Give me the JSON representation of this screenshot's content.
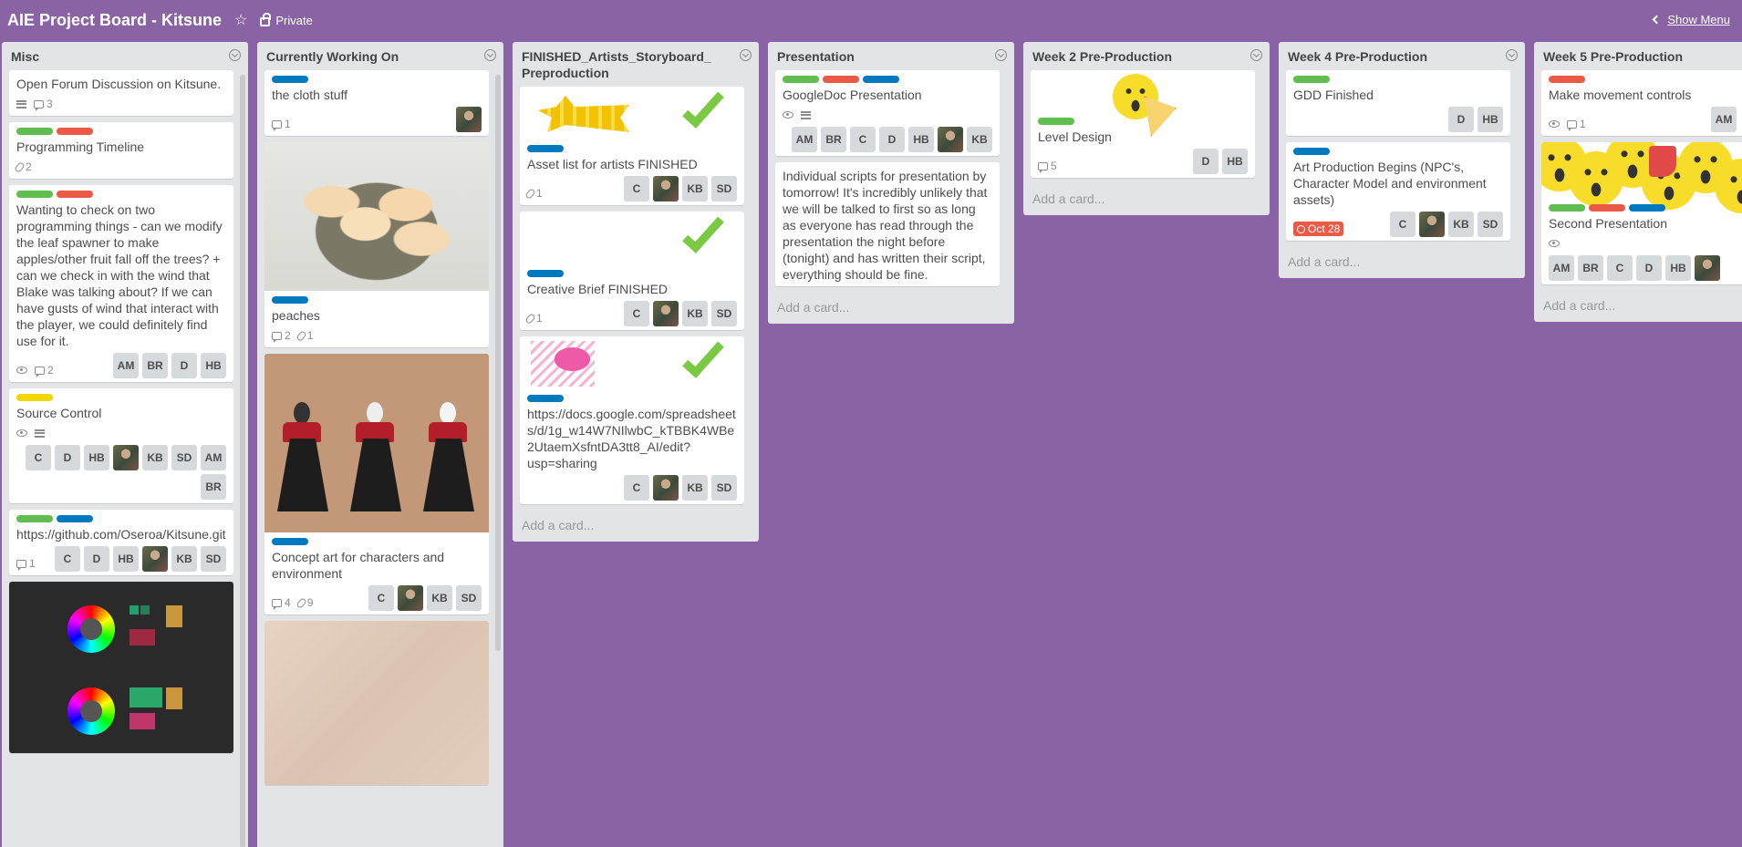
{
  "header": {
    "board_title": "AIE Project Board - Kitsune",
    "visibility": "Private",
    "show_menu": "Show Menu"
  },
  "colors": {
    "board_bg": "#8a63a4",
    "label_green": "#61bd4f",
    "label_red": "#eb5a46",
    "label_blue": "#0079bf",
    "label_yellow": "#f2d600"
  },
  "add_card": "Add a card...",
  "lists": [
    {
      "title": "Misc",
      "cards": [
        {
          "title": "Open Forum Discussion on Kitsune.",
          "comments": "3"
        },
        {
          "title": "Programming Timeline",
          "attachments": "2"
        },
        {
          "title": "Wanting to check on two programming things - can we modify the leaf spawner to make apples/other fruit fall off the trees? + can we check in with the wind that Blake was talking about? If we can have gusts of wind that interact with the player, we could definitely find use for it.",
          "comments": "2",
          "members": [
            "AM",
            "BR",
            "D",
            "HB"
          ]
        },
        {
          "title": "Source Control",
          "members": [
            "C",
            "D",
            "HB",
            "KB",
            "SD",
            "AM",
            "BR"
          ]
        },
        {
          "title": "https://github.com/Oseroa/Kitsune.git",
          "comments": "1",
          "members": [
            "C",
            "D",
            "HB",
            "KB",
            "SD"
          ]
        }
      ]
    },
    {
      "title": "Currently Working On",
      "cards": [
        {
          "title": "the cloth stuff",
          "comments": "1"
        },
        {
          "title": "peaches",
          "comments": "2",
          "attachments": "1"
        },
        {
          "title": "Concept art for characters and environment",
          "comments": "4",
          "attachments": "9",
          "members": [
            "C",
            "KB",
            "SD"
          ]
        }
      ]
    },
    {
      "title": "FINISHED_Artists_Storyboard_ Preproduction",
      "cards": [
        {
          "title": "Asset list for artists FINISHED",
          "attachments": "1",
          "members": [
            "C",
            "KB",
            "SD"
          ]
        },
        {
          "title": "Creative Brief FINISHED",
          "attachments": "1",
          "members": [
            "C",
            "KB",
            "SD"
          ]
        },
        {
          "title": "https://docs.google.com/spreadsheets/d/1g_w14W7NIlwbC_kTBBK4WBe2UtaemXsfntDA3tt8_AI/edit?usp=sharing",
          "members": [
            "C",
            "KB",
            "SD"
          ]
        }
      ]
    },
    {
      "title": "Presentation",
      "cards": [
        {
          "title": "GoogleDoc Presentation",
          "members": [
            "AM",
            "BR",
            "C",
            "D",
            "HB",
            "KB"
          ]
        },
        {
          "title": "Individual scripts for presentation by tomorrow! It's incredibly unlikely that we will be talked to first so as long as everyone has read through the presentation the night before (tonight) and has written their script, everything should be fine."
        }
      ]
    },
    {
      "title": "Week 2 Pre-Production",
      "cards": [
        {
          "title": "Level Design",
          "comments": "5",
          "members": [
            "D",
            "HB"
          ]
        }
      ]
    },
    {
      "title": "Week 4 Pre-Production",
      "cards": [
        {
          "title": "GDD Finished",
          "members": [
            "D",
            "HB"
          ]
        },
        {
          "title": "Art Production Begins (NPC's, Character Model and environment assets)",
          "due": "Oct 28",
          "members": [
            "C",
            "KB",
            "SD"
          ]
        }
      ]
    },
    {
      "title": "Week 5 Pre-Production",
      "cards": [
        {
          "title": "Make movement controls",
          "comments": "1",
          "members": [
            "AM"
          ]
        },
        {
          "title": "Second Presentation",
          "members": [
            "AM",
            "BR",
            "C",
            "D",
            "HB"
          ]
        }
      ]
    }
  ]
}
